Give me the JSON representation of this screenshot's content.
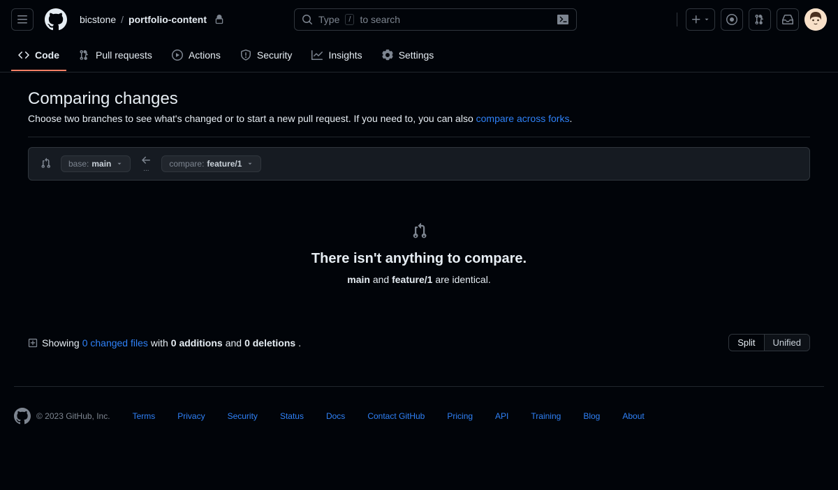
{
  "header": {
    "owner": "bicstone",
    "separator": "/",
    "repo": "portfolio-content",
    "search_prefix": "Type",
    "search_key": "/",
    "search_suffix": "to search"
  },
  "nav": {
    "code": "Code",
    "pulls": "Pull requests",
    "actions": "Actions",
    "security": "Security",
    "insights": "Insights",
    "settings": "Settings"
  },
  "main": {
    "title": "Comparing changes",
    "desc_prefix": "Choose two branches to see what's changed or to start a new pull request. If you need to, you can also ",
    "desc_link": "compare across forks",
    "desc_suffix": ".",
    "base_label": "base:",
    "base_value": "main",
    "compare_label": "compare:",
    "compare_value": "feature/1"
  },
  "empty": {
    "heading": "There isn't anything to compare.",
    "msg_b1": "main",
    "msg_mid": " and ",
    "msg_b2": "feature/1",
    "msg_end": " are identical."
  },
  "diff": {
    "showing": "Showing ",
    "files_link": "0 changed files",
    "with": " with ",
    "additions": "0 additions",
    "and": " and ",
    "deletions": "0 deletions",
    "dot": ".",
    "split": "Split",
    "unified": "Unified"
  },
  "footer": {
    "copyright": "© 2023 GitHub, Inc.",
    "links": [
      "Terms",
      "Privacy",
      "Security",
      "Status",
      "Docs",
      "Contact GitHub",
      "Pricing",
      "API",
      "Training",
      "Blog",
      "About"
    ]
  }
}
